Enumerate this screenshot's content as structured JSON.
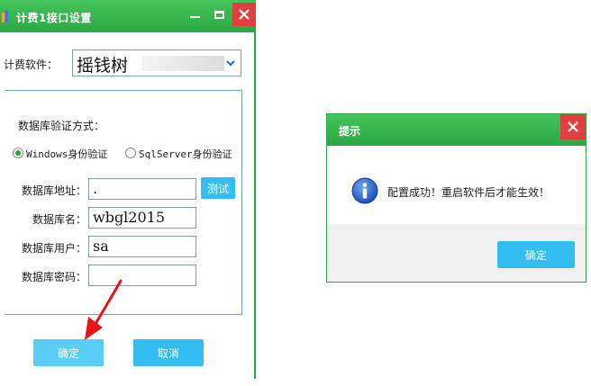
{
  "main_window": {
    "title": "计费1接口设置",
    "billing_label": "计费软件：",
    "billing_value": "摇钱树",
    "auth_label": "数据库验证方式：",
    "auth_options": [
      {
        "label": "Windows身份验证",
        "checked": true
      },
      {
        "label": "SqlServer身份验证",
        "checked": false
      }
    ],
    "fields": {
      "address": {
        "label": "数据库地址：",
        "value": "."
      },
      "name": {
        "label": "数据库名：",
        "value": "wbgl2015"
      },
      "user": {
        "label": "数据库用户：",
        "value": "sa"
      },
      "password": {
        "label": "数据库密码：",
        "value": ""
      }
    },
    "test_button": "测试",
    "ok_button": "确定",
    "cancel_button": "取消"
  },
  "dialog": {
    "title": "提示",
    "message": "配置成功！重启软件后才能生效！",
    "ok_button": "确定"
  },
  "colors": {
    "titlebar_green": "#2aa843",
    "close_red": "#e24040",
    "button_blue": "#33bdf0",
    "annotation_arrow": "#e8141c"
  },
  "icons": {
    "app": "app-logo-icon",
    "minimize": "minimize-icon",
    "maximize": "maximize-icon",
    "close": "close-icon",
    "dropdown": "chevron-down-icon",
    "info": "info-icon",
    "annotation": "red-arrow-icon"
  }
}
